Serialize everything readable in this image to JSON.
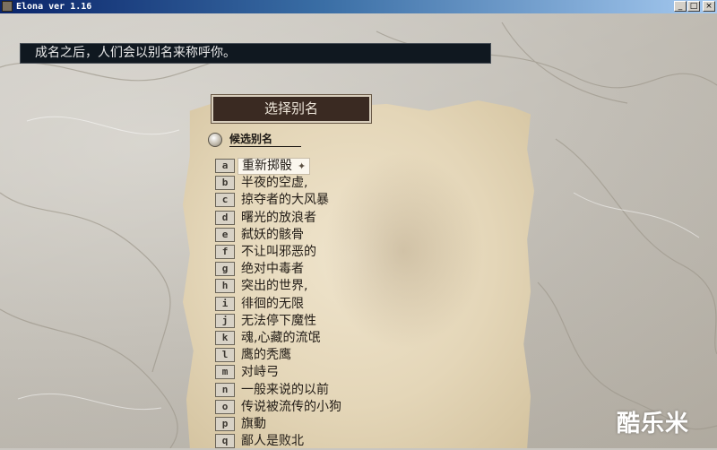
{
  "window": {
    "title": "Elona ver 1.16",
    "buttons": {
      "minimize": "_",
      "maximize": "□",
      "close": "×"
    }
  },
  "message": "成名之后，人们会以别名来称呼你。",
  "dialog": {
    "header": "选择别名",
    "section_title": "候选别名",
    "items": [
      {
        "key": "a",
        "label": "重新掷骰",
        "selected": true
      },
      {
        "key": "b",
        "label": "半夜的空虚,"
      },
      {
        "key": "c",
        "label": "掠夺者的大风暴"
      },
      {
        "key": "d",
        "label": "曙光的放浪者"
      },
      {
        "key": "e",
        "label": "弑妖的骸骨"
      },
      {
        "key": "f",
        "label": "不让叫邪恶的"
      },
      {
        "key": "g",
        "label": "绝对中毒者"
      },
      {
        "key": "h",
        "label": "突出的世界,"
      },
      {
        "key": "i",
        "label": "徘徊的无限"
      },
      {
        "key": "j",
        "label": "无法停下魔性"
      },
      {
        "key": "k",
        "label": "魂,心藏的流氓"
      },
      {
        "key": "l",
        "label": "鹰的秃鹰"
      },
      {
        "key": "m",
        "label": "对峙弓"
      },
      {
        "key": "n",
        "label": "一般来说的以前"
      },
      {
        "key": "o",
        "label": "传说被流传的小狗"
      },
      {
        "key": "p",
        "label": "旗動"
      },
      {
        "key": "q",
        "label": "鄙人是败北"
      }
    ]
  },
  "watermark": "酷乐米"
}
